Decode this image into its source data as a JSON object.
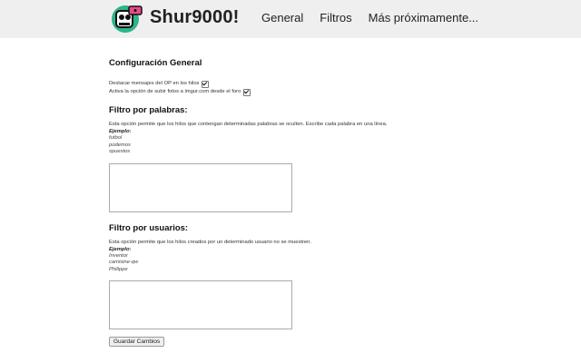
{
  "header": {
    "brand": "Shur9000!",
    "nav": [
      "General",
      "Filtros",
      "Más próximamente..."
    ]
  },
  "general": {
    "title": "Configuración General",
    "options": [
      {
        "label": "Destacar mensajes del OP en los hilos",
        "checked": true
      },
      {
        "label": "Activa la opción de subir fotos a imgur.com desde el foro",
        "checked": true
      }
    ]
  },
  "word_filter": {
    "title": "Filtro por palabras:",
    "description": "Esta opción permite que los hilos que contengan determinadas palabras se oculten. Escribe cada palabra en una línea.",
    "example_label": "Ejemplo:",
    "examples": [
      "futbol",
      "podemos",
      "spuestos"
    ]
  },
  "user_filter": {
    "title": "Filtro por usuarios:",
    "description": "Esta opción permite que los hilos creados por un determinado usuario no se muestren.",
    "example_label": "Ejemplo:",
    "examples": [
      "Inventor",
      "camisine-qw",
      "Philippe"
    ]
  },
  "save_label": "Guardar Cambios",
  "colors": {
    "logo_green": "#2bb58a",
    "logo_pink": "#e84a8a"
  }
}
